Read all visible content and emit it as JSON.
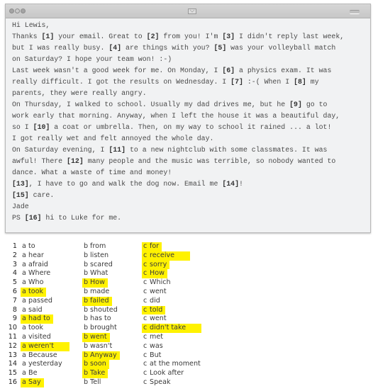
{
  "window": {
    "title_icon": "mail-icon",
    "controls": [
      "close-dot",
      "minimize-dot",
      "zoom-dot"
    ],
    "menu_icon": "menu-icon"
  },
  "email": {
    "lines": [
      [
        {
          "t": "Hi Lewis,"
        }
      ],
      [
        {
          "t": "Thanks "
        },
        {
          "b": "[1]"
        },
        {
          "t": " your email. Great to "
        },
        {
          "b": "[2]"
        },
        {
          "t": " from you! I'm "
        },
        {
          "b": "[3]"
        },
        {
          "t": " I didn't reply last week,"
        }
      ],
      [
        {
          "t": "but I was really busy. "
        },
        {
          "b": "[4]"
        },
        {
          "t": " are things with you? "
        },
        {
          "b": "[5]"
        },
        {
          "t": " was your volleyball match"
        }
      ],
      [
        {
          "t": "on Saturday? I hope your team won! :-)"
        }
      ],
      [
        {
          "t": "Last week wasn't a good week for me. On Monday, I "
        },
        {
          "b": "[6]"
        },
        {
          "t": " a physics exam. It was"
        }
      ],
      [
        {
          "t": "really difficult. I got the results on Wednesday. I "
        },
        {
          "b": "[7]"
        },
        {
          "t": " :-( When I "
        },
        {
          "b": "[8]"
        },
        {
          "t": " my"
        }
      ],
      [
        {
          "t": "parents, they were really angry."
        }
      ],
      [
        {
          "t": "On Thursday, I walked to school. Usually my dad drives me, but he "
        },
        {
          "b": "[9]"
        },
        {
          "t": " go to"
        }
      ],
      [
        {
          "t": "work early that morning. Anyway, when I left the house it was a beautiful day,"
        }
      ],
      [
        {
          "t": "so I "
        },
        {
          "b": "[10]"
        },
        {
          "t": " a coat or umbrella. Then, on my way to school it rained ... a lot!"
        }
      ],
      [
        {
          "t": "I got really wet and felt annoyed the whole day."
        }
      ],
      [
        {
          "t": "On Saturday evening, I "
        },
        {
          "b": "[11]"
        },
        {
          "t": " to a new nightclub with some classmates. It was"
        }
      ],
      [
        {
          "t": "awful! There "
        },
        {
          "b": "[12]"
        },
        {
          "t": " many people and the music was terrible, so nobody wanted to"
        }
      ],
      [
        {
          "t": "dance. What a waste of time and money!"
        }
      ],
      [
        {
          "b": "[13]"
        },
        {
          "t": ", I have to go and walk the dog now. Email me "
        },
        {
          "b": "[14]"
        },
        {
          "t": "!"
        }
      ],
      [
        {
          "b": "[15]"
        },
        {
          "t": " care."
        }
      ],
      [
        {
          "t": "Jade"
        }
      ],
      [
        {
          "t": "PS "
        },
        {
          "b": "[16]"
        },
        {
          "t": " hi to Luke for me."
        }
      ]
    ]
  },
  "answers": {
    "highlight_color": "#fff200",
    "items": [
      {
        "n": "1",
        "a": "to",
        "b": "from",
        "c": "for",
        "selected": "c"
      },
      {
        "n": "2",
        "a": "hear",
        "b": "listen",
        "c": "receive",
        "selected": "c"
      },
      {
        "n": "3",
        "a": "afraid",
        "b": "scared",
        "c": "sorry",
        "selected": "c"
      },
      {
        "n": "4",
        "a": "Where",
        "b": "What",
        "c": "How",
        "selected": "c"
      },
      {
        "n": "5",
        "a": "Who",
        "b": "How",
        "c": "Which",
        "selected": "b"
      },
      {
        "n": "6",
        "a": "took",
        "b": "made",
        "c": "went",
        "selected": "a"
      },
      {
        "n": "7",
        "a": "passed",
        "b": "failed",
        "c": "did",
        "selected": "b"
      },
      {
        "n": "8",
        "a": "said",
        "b": "shouted",
        "c": "told",
        "selected": "c"
      },
      {
        "n": "9",
        "a": "had to",
        "b": "has to",
        "c": "went",
        "selected": "a"
      },
      {
        "n": "10",
        "a": "took",
        "b": "brought",
        "c": "didn't take",
        "selected": "c"
      },
      {
        "n": "11",
        "a": "visited",
        "b": "went",
        "c": "met",
        "selected": "b"
      },
      {
        "n": "12",
        "a": "weren't",
        "b": "wasn't",
        "c": "was",
        "selected": "a"
      },
      {
        "n": "13",
        "a": "Because",
        "b": "Anyway",
        "c": "But",
        "selected": "b"
      },
      {
        "n": "14",
        "a": "yesterday",
        "b": "soon",
        "c": "at the moment",
        "selected": "b"
      },
      {
        "n": "15",
        "a": "Be",
        "b": "Take",
        "c": "Look after",
        "selected": "b"
      },
      {
        "n": "16",
        "a": "Say",
        "b": "Tell",
        "c": "Speak",
        "selected": "a"
      }
    ]
  }
}
